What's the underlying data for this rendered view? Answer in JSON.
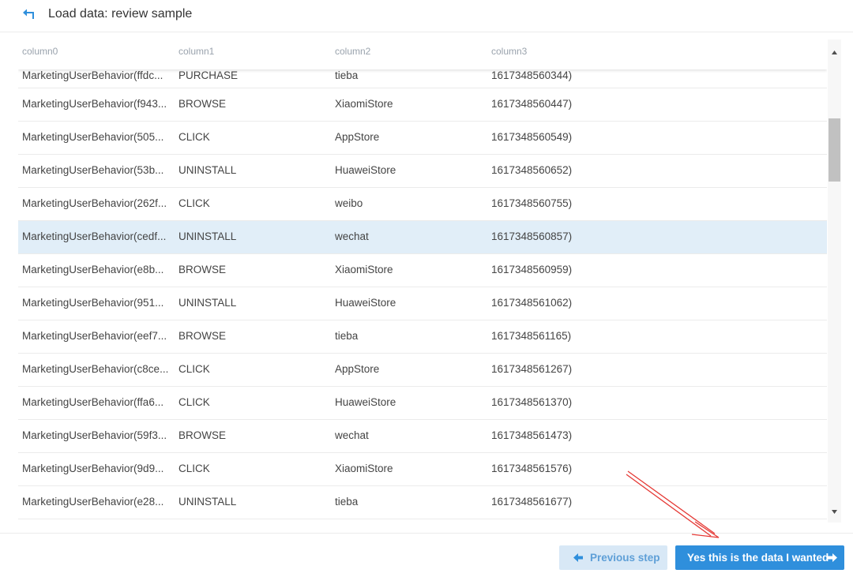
{
  "header": {
    "title": "Load data: review sample"
  },
  "table": {
    "columns": [
      "column0",
      "column1",
      "column2",
      "column3"
    ],
    "rows": [
      [
        "MarketingUserBehavior(ffdc...",
        "PURCHASE",
        "tieba",
        "1617348560344)"
      ],
      [
        "MarketingUserBehavior(f943...",
        "BROWSE",
        "XiaomiStore",
        "1617348560447)"
      ],
      [
        "MarketingUserBehavior(505...",
        "CLICK",
        "AppStore",
        "1617348560549)"
      ],
      [
        "MarketingUserBehavior(53b...",
        "UNINSTALL",
        "HuaweiStore",
        "1617348560652)"
      ],
      [
        "MarketingUserBehavior(262f...",
        "CLICK",
        "weibo",
        "1617348560755)"
      ],
      [
        "MarketingUserBehavior(cedf...",
        "UNINSTALL",
        "wechat",
        "1617348560857)"
      ],
      [
        "MarketingUserBehavior(e8b...",
        "BROWSE",
        "XiaomiStore",
        "1617348560959)"
      ],
      [
        "MarketingUserBehavior(951...",
        "UNINSTALL",
        "HuaweiStore",
        "1617348561062)"
      ],
      [
        "MarketingUserBehavior(eef7...",
        "BROWSE",
        "tieba",
        "1617348561165)"
      ],
      [
        "MarketingUserBehavior(c8ce...",
        "CLICK",
        "AppStore",
        "1617348561267)"
      ],
      [
        "MarketingUserBehavior(ffa6...",
        "CLICK",
        "HuaweiStore",
        "1617348561370)"
      ],
      [
        "MarketingUserBehavior(59f3...",
        "BROWSE",
        "wechat",
        "1617348561473)"
      ],
      [
        "MarketingUserBehavior(9d9...",
        "CLICK",
        "XiaomiStore",
        "1617348561576)"
      ],
      [
        "MarketingUserBehavior(e28...",
        "UNINSTALL",
        "tieba",
        "1617348561677)"
      ]
    ],
    "selected_row_index": 5
  },
  "footer": {
    "previous_label": "Previous step",
    "next_label": "Yes this is the data I wanted"
  },
  "icons": {
    "back": "back-arrow-icon",
    "previous": "arrow-left-icon",
    "next": "arrow-right-icon",
    "scroll_up": "triangle-up-icon",
    "scroll_down": "triangle-down-icon"
  },
  "colors": {
    "accent": "#2f8fdc",
    "selected_row": "#e1eef8",
    "secondary_button": "#d8e8f6",
    "annotation": "#e53935"
  }
}
